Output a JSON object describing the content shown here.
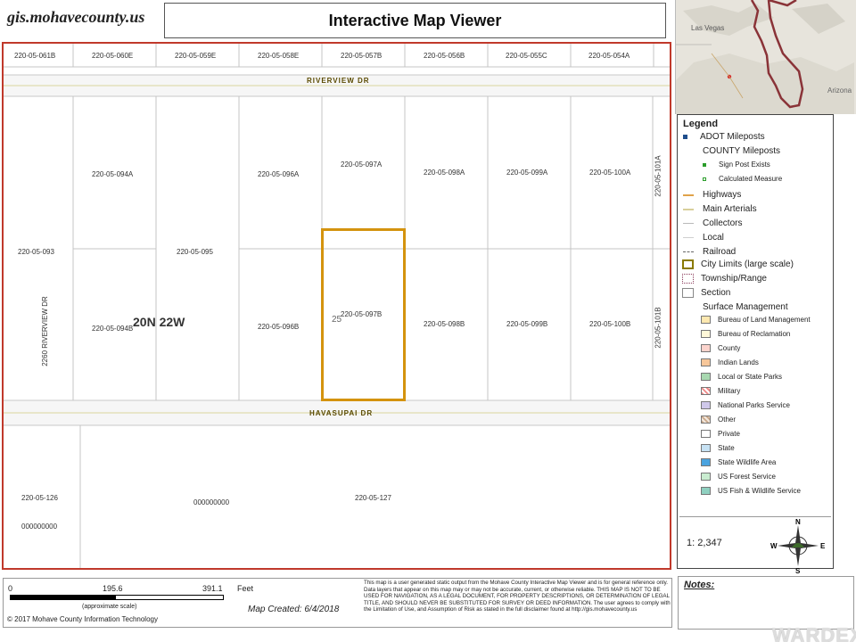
{
  "header": {
    "logo": "gis.mohavecounty.us",
    "title": "Interactive Map Viewer"
  },
  "inset": {
    "place_labels": [
      "Las Vegas",
      "Arizona"
    ]
  },
  "map": {
    "township": "20N 22W",
    "section": "25",
    "streets": [
      "RIVERVIEW DR",
      "HAVASUPAI DR"
    ],
    "parcels_top_row": [
      "220-05-061B",
      "220-05-060E",
      "220-05-059E",
      "220-05-058E",
      "220-05-057B",
      "220-05-056B",
      "220-05-055C",
      "220-05-054A"
    ],
    "parcels_upper": [
      "220-05-094A",
      "220-05-096A",
      "220-05-097A",
      "220-05-098A",
      "220-05-099A",
      "220-05-100A"
    ],
    "parcels_lower": [
      "220-05-094B",
      "220-05-096B",
      "220-05-097B",
      "220-05-098B",
      "220-05-099B",
      "220-05-100B"
    ],
    "parcel_093": "220-05-093",
    "parcel_095": "220-05-095",
    "parcel_101a": "220-05-101A",
    "parcel_101b": "220-05-101B",
    "address_riverview": "2260 RIVERVIEW DR",
    "parcel_126": "220-05-126",
    "parcel_127": "220-05-127",
    "zeros_a": "000000000",
    "zeros_b": "000000000",
    "selected_parcel": "220-05-097B",
    "selected_color": "#d4930e"
  },
  "legend": {
    "title": "Legend",
    "items": [
      {
        "label": "ADOT Mileposts",
        "small": false
      },
      {
        "label": "COUNTY Mileposts",
        "small": false
      },
      {
        "label": "Sign Post Exists",
        "small": true
      },
      {
        "label": "Calculated Measure",
        "small": true
      },
      {
        "label": "Highways",
        "small": false
      },
      {
        "label": "Main Arterials",
        "small": false
      },
      {
        "label": "Collectors",
        "small": false
      },
      {
        "label": "Local",
        "small": false
      },
      {
        "label": "Railroad",
        "small": false
      },
      {
        "label": "City Limits (large scale)",
        "small": false
      },
      {
        "label": "Township/Range",
        "small": false
      },
      {
        "label": "Section",
        "small": false
      },
      {
        "label": "Surface Management",
        "small": false
      }
    ],
    "surface": [
      {
        "label": "Bureau of Land Management",
        "color": "#fde8b0"
      },
      {
        "label": "Bureau of Reclamation",
        "color": "#fff8d8"
      },
      {
        "label": "County",
        "color": "#fbd3cc"
      },
      {
        "label": "Indian Lands",
        "color": "#f7c79a"
      },
      {
        "label": "Local or State Parks",
        "color": "#a8d8b0"
      },
      {
        "label": "Military",
        "color": "#f4b8b8"
      },
      {
        "label": "National Parks Service",
        "color": "#cfc8ea"
      },
      {
        "label": "Other",
        "color": "#e2c7b0"
      },
      {
        "label": "Private",
        "color": "#ffffff"
      },
      {
        "label": "State",
        "color": "#c7e2f4"
      },
      {
        "label": "State Wildlife Area",
        "color": "#4aa3df"
      },
      {
        "label": "US Forest Service",
        "color": "#c9ecd0"
      },
      {
        "label": "US Fish & Wildlife Service",
        "color": "#8fd0c0"
      }
    ],
    "scale_ratio": "1: 2,347",
    "compass": {
      "n": "N",
      "s": "S",
      "e": "E",
      "w": "W"
    }
  },
  "footer": {
    "scale": {
      "zero": "0",
      "mid": "195.6",
      "end": "391.1",
      "units": "Feet",
      "note": "(approximate scale)"
    },
    "copyright": "© 2017 Mohave County Information Technology",
    "created": "Map Created: 6/4/2018",
    "disclaimer": "This map is a user generated static output from the Mohave County Interactive Map Viewer and is for general reference only. Data layers that appear on this map may or may not be accurate, current, or otherwise reliable. THIS MAP IS NOT TO BE USED FOR NAVIGATION, AS A LEGAL DOCUMENT, FOR PROPERTY DESCRIPTIONS, OR DETERMINATION OF LEGAL TITLE, AND SHOULD NEVER BE SUBSTITUTED FOR SURVEY OR DEED INFORMATION. The user agrees to comply with the Limitation of Use, and Assumption of Risk as stated in the full disclaimer found at http://gis.mohavecounty.us",
    "notes": "Notes:",
    "watermark": "WARDEX"
  }
}
